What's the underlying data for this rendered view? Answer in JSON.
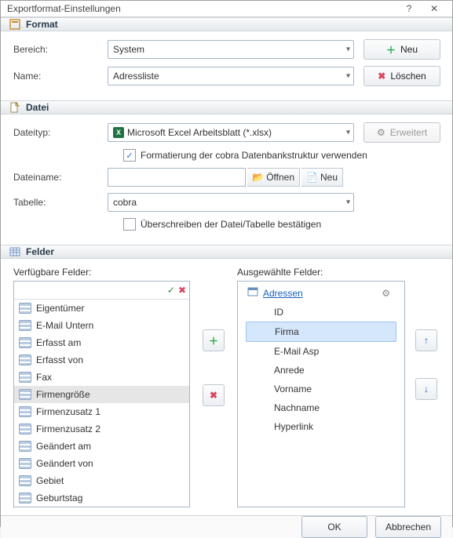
{
  "window": {
    "title": "Exportformat-Einstellungen"
  },
  "sections": {
    "format": "Format",
    "datei": "Datei",
    "felder": "Felder"
  },
  "format": {
    "bereich_label": "Bereich:",
    "bereich_value": "System",
    "name_label": "Name:",
    "name_value": "Adressliste",
    "btn_new": "Neu",
    "btn_delete": "Löschen"
  },
  "datei": {
    "dateityp_label": "Dateityp:",
    "dateityp_value": "Microsoft Excel Arbeitsblatt (*.xlsx)",
    "erweitert": "Erweitert",
    "formatierung": "Formatierung der cobra Datenbankstruktur verwenden",
    "dateiname_label": "Dateiname:",
    "dateiname_value": "",
    "oeffnen": "Öffnen",
    "neu": "Neu",
    "tabelle_label": "Tabelle:",
    "tabelle_value": "cobra",
    "ueberschreiben": "Überschreiben der Datei/Tabelle bestätigen"
  },
  "felder": {
    "available_label": "Verfügbare Felder:",
    "selected_label": "Ausgewählte Felder:",
    "filter_value": "",
    "root_link": "Adressen",
    "available": [
      "Eigentümer",
      "E-Mail Untern",
      "Erfasst am",
      "Erfasst von",
      "Fax",
      "Firmengröße",
      "Firmenzusatz 1",
      "Firmenzusatz 2",
      "Geändert am",
      "Geändert von",
      "Gebiet",
      "Geburtstag"
    ],
    "available_selected_index": 5,
    "selected": [
      "ID",
      "Firma",
      "E-Mail Asp",
      "Anrede",
      "Vorname",
      "Nachname",
      "Hyperlink"
    ],
    "selected_selected_index": 1
  },
  "footer": {
    "ok": "OK",
    "cancel": "Abbrechen"
  }
}
